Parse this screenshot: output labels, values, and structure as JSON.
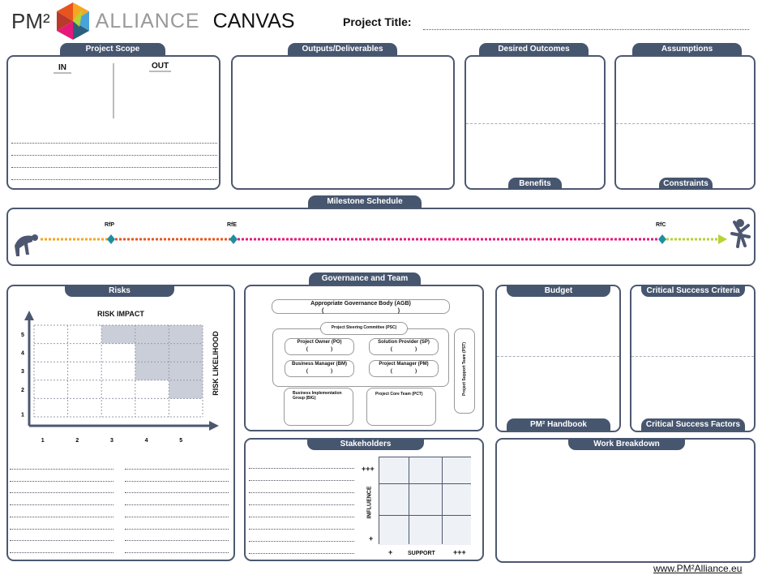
{
  "header": {
    "brand_pm": "PM²",
    "brand_alliance": "ALLIANCE",
    "brand_canvas": "CANVAS",
    "project_title_label": "Project Title:",
    "project_title_value": ""
  },
  "colors": {
    "tab": "#47566f",
    "border": "#4d5870",
    "risk_shade": "#c9ced8",
    "stake_grid": "#eef1f6"
  },
  "scope": {
    "title": "Project Scope",
    "in": "IN",
    "out": "OUT"
  },
  "outputs": {
    "title": "Outputs/Deliverables"
  },
  "outcomes": {
    "title": "Desired Outcomes",
    "bottom": "Benefits"
  },
  "assumptions": {
    "title": "Assumptions",
    "bottom": "Constraints"
  },
  "milestones": {
    "title": "Milestone Schedule",
    "items": [
      {
        "label": "RfP",
        "color": "#f5a623"
      },
      {
        "label": "RfE",
        "color": "#e8541e"
      },
      {
        "label": "RfC",
        "color": "#e6197a"
      }
    ],
    "end_color": "#b5d334",
    "start_icon": "runner-start-icon",
    "finish_icon": "runner-finish-icon"
  },
  "risks": {
    "title": "Risks",
    "impact_label": "RISK IMPACT",
    "likelihood_label": "RISK LIKELIHOOD",
    "x_ticks": [
      "1",
      "2",
      "3",
      "4",
      "5"
    ],
    "y_ticks": [
      "1",
      "2",
      "3",
      "4",
      "5"
    ],
    "shaded": [
      [
        5,
        3
      ],
      [
        5,
        4
      ],
      [
        5,
        5
      ],
      [
        4,
        4
      ],
      [
        4,
        5
      ],
      [
        3,
        4
      ],
      [
        3,
        5
      ],
      [
        2,
        5
      ]
    ]
  },
  "governance": {
    "title": "Governance and Team",
    "agb": "Appropriate Governance Body (AGB)",
    "psc": "Project Steering Committee (PSC)",
    "po": "Project Owner (PO)",
    "sp": "Solution Provider (SP)",
    "bm": "Business Manager (BM)",
    "pm": "Project Manager (PM)",
    "big": "Business Implementation Group (BIG)",
    "pct": "Project Core Team (PCT)",
    "pst": "Project Support Team (PST)",
    "paren_open": "(",
    "paren_close": ")"
  },
  "stakeholders": {
    "title": "Stakeholders",
    "influence": "INFLUENCE",
    "support": "SUPPORT",
    "plus": "+",
    "plus3": "+++"
  },
  "budget": {
    "title": "Budget",
    "bottom": "PM² Handbook"
  },
  "csc": {
    "title": "Critical Success Criteria",
    "bottom": "Critical Success Factors"
  },
  "work": {
    "title": "Work Breakdown"
  },
  "footer": {
    "url": "www.PM²Alliance.eu"
  }
}
